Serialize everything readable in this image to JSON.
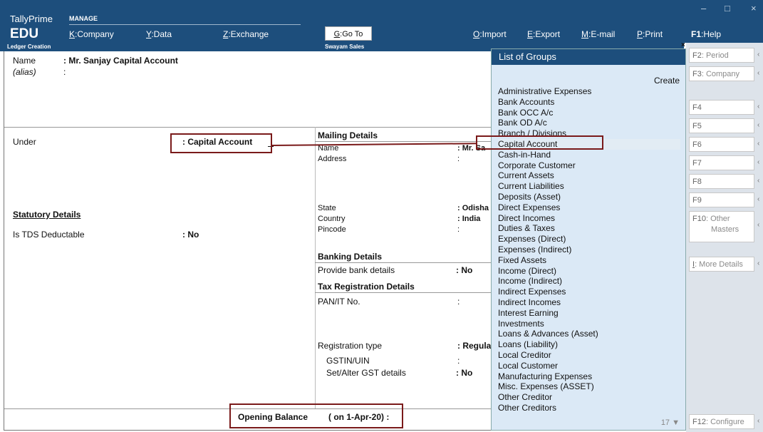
{
  "app": {
    "brand": "TallyPrime",
    "edition": "EDU",
    "manage": "MANAGE"
  },
  "menu": [
    {
      "key": "K",
      "label": ":Company"
    },
    {
      "key": "Y",
      "label": ":Data"
    },
    {
      "key": "Z",
      "label": ":Exchange"
    },
    {
      "key": "G",
      "label": ":Go To"
    },
    {
      "key": "O",
      "label": ":Import"
    },
    {
      "key": "E",
      "label": ":Export"
    },
    {
      "key": "M",
      "label": ":E-mail"
    },
    {
      "key": "P",
      "label": ":Print"
    },
    {
      "key": "F1",
      "label": ":Help"
    }
  ],
  "window_controls": {
    "minimize": "–",
    "maximize": "□",
    "close": "×"
  },
  "subbar": {
    "screen": "Ledger Creation",
    "company": "Swayam Sales",
    "close": "×"
  },
  "ledger": {
    "name_label": "Name",
    "name_value": ": Mr. Sanjay Capital Account",
    "alias_label": "(alias)",
    "alias_value": ":",
    "under_label": "Under",
    "under_value": ": Capital Account",
    "statutory_title": "Statutory Details",
    "tds_label": "Is TDS Deductable",
    "tds_value": ": No",
    "opening_label": "Opening Balance",
    "opening_date": "( on 1-Apr-20) :"
  },
  "mailing": {
    "title": "Mailing Details",
    "name_label": "Name",
    "name_value": ": Mr. Sa",
    "address_label": "Address",
    "address_value": ":",
    "state_label": "State",
    "state_value": ": Odisha",
    "country_label": "Country",
    "country_value": ": India",
    "pincode_label": "Pincode",
    "pincode_value": ":"
  },
  "banking": {
    "title": "Banking Details",
    "bank_label": "Provide bank details",
    "bank_value": ": No"
  },
  "tax": {
    "title": "Tax Registration Details",
    "pan_label": "PAN/IT No.",
    "pan_value": ":",
    "regtype_label": "Registration type",
    "regtype_value": ": Regula",
    "gstin_label": "GSTIN/UIN",
    "gstin_value": ":",
    "setalter_label": "Set/Alter GST details",
    "setalter_value": ": No"
  },
  "groups": {
    "title": "List of Groups",
    "create": "Create",
    "count": "17 ▼",
    "items": [
      "Administrative Expenses",
      "Bank Accounts",
      "Bank OCC A/c",
      "Bank OD A/c",
      "Branch / Divisions",
      "Capital Account",
      "Cash-in-Hand",
      "Corporate Customer",
      "Current Assets",
      "Current Liabilities",
      "Deposits (Asset)",
      "Direct Expenses",
      "Direct Incomes",
      "Duties & Taxes",
      "Expenses (Direct)",
      "Expenses (Indirect)",
      "Fixed Assets",
      "Income (Direct)",
      "Income (Indirect)",
      "Indirect Expenses",
      "Indirect Incomes",
      "Interest Earning",
      "Investments",
      "Loans & Advances (Asset)",
      "Loans (Liability)",
      "Local Creditor",
      "Local Customer",
      "Manufacturing Expenses",
      "Misc. Expenses (ASSET)",
      "Other Creditor",
      "Other Creditors"
    ],
    "selected_index": 5
  },
  "fkeys": [
    {
      "key": "F2",
      "label": ": Period"
    },
    {
      "key": "F3",
      "label": ": Company"
    },
    {
      "key": "F4",
      "label": ""
    },
    {
      "key": "F5",
      "label": ""
    },
    {
      "key": "F6",
      "label": ""
    },
    {
      "key": "F7",
      "label": ""
    },
    {
      "key": "F8",
      "label": ""
    },
    {
      "key": "F9",
      "label": ""
    },
    {
      "key": "F10",
      "label": ": Other",
      "label2": "Masters"
    },
    {
      "key": "I",
      "label": ": More Details"
    },
    {
      "key": "F12",
      "label": ": Configure"
    }
  ],
  "fkey_arrow": "‹",
  "colors": {
    "header": "#1d4e7c",
    "highlight_box": "#7a1a1a",
    "group_panel": "#dbe9f6"
  }
}
